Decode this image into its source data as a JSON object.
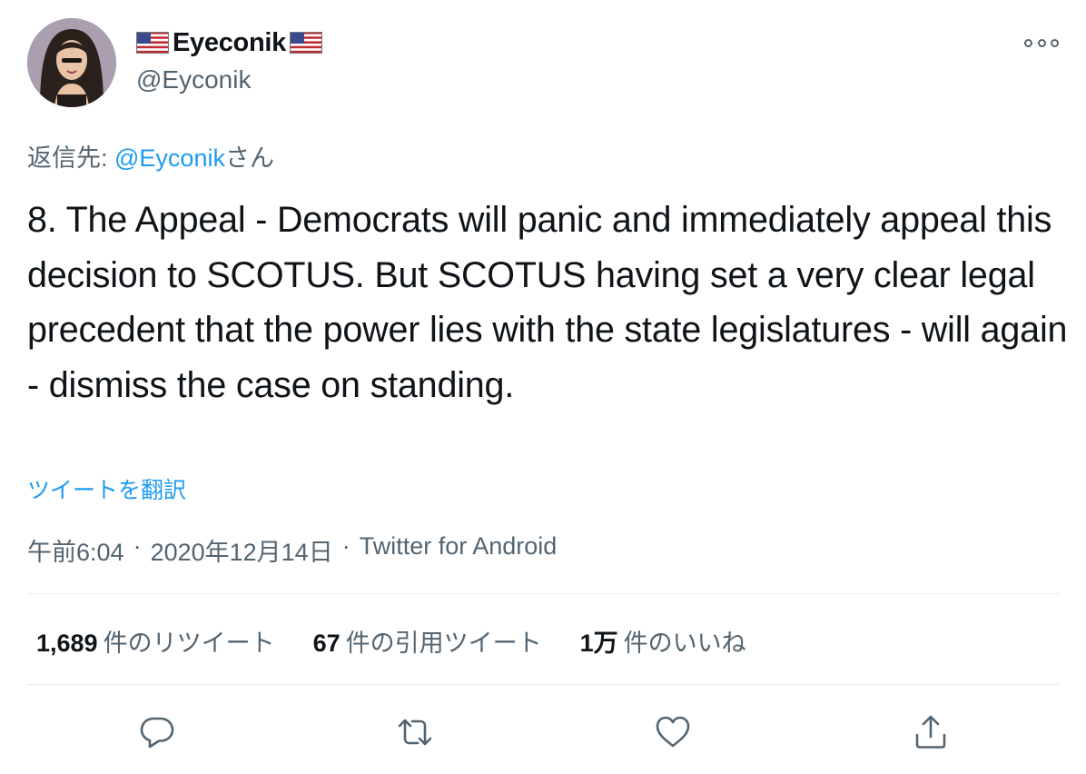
{
  "author": {
    "display_name": "Eyeconik",
    "handle": "@Eyconik",
    "name_emoji": "flag-us"
  },
  "reply_to": {
    "prefix": "返信先: ",
    "mention": "@Eyconik",
    "suffix": "さん"
  },
  "tweet": {
    "text": "8. The Appeal - Democrats will panic and immediately appeal this decision to SCOTUS. But SCOTUS having set a very clear legal precedent that the power lies with the state legislatures - will again - dismiss the case on standing.",
    "translate_label": "ツイートを翻訳"
  },
  "meta": {
    "time": "午前6:04",
    "separator": "·",
    "date": "2020年12月14日",
    "source": "Twitter for Android"
  },
  "stats": {
    "retweets_count": "1,689",
    "retweets_label": "件のリツイート",
    "quotes_count": "67",
    "quotes_label": "件の引用ツイート",
    "likes_count": "1万",
    "likes_label": "件のいいね"
  },
  "icons": {
    "more": "more-icon",
    "reply": "reply-icon",
    "retweet": "retweet-icon",
    "like": "heart-icon",
    "share": "share-icon"
  },
  "colors": {
    "text": "#0f1419",
    "secondary": "#536471",
    "link": "#1d9bf0",
    "divider": "#e6ecf0"
  }
}
